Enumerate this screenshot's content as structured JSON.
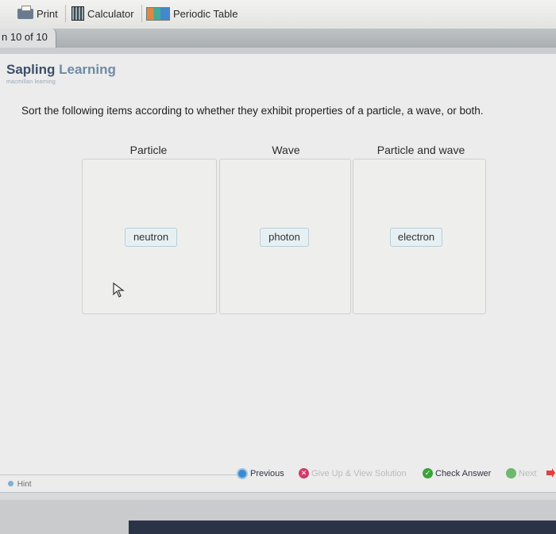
{
  "toolbar": {
    "print_label": "Print",
    "calculator_label": "Calculator",
    "periodic_label": "Periodic Table"
  },
  "question_tab": {
    "label": "n 10 of 10"
  },
  "brand": {
    "name_part1": "Sapling",
    "name_part2": "Learning",
    "sub": "macmillan learning"
  },
  "instruction": "Sort the following items according to whether they exhibit properties of a particle, a wave, or both.",
  "columns": [
    {
      "heading": "Particle",
      "item": "neutron"
    },
    {
      "heading": "Wave",
      "item": "photon"
    },
    {
      "heading": "Particle and wave",
      "item": "electron"
    }
  ],
  "nav": {
    "previous": "Previous",
    "give_up": "Give Up & View Solution",
    "check": "Check Answer",
    "next": "Next"
  },
  "hint_label": "Hint",
  "colors": {
    "brand": "#3c4f6b",
    "check": "#3aa33a",
    "give_up": "#d23a6a",
    "previous": "#3a8ad0"
  }
}
